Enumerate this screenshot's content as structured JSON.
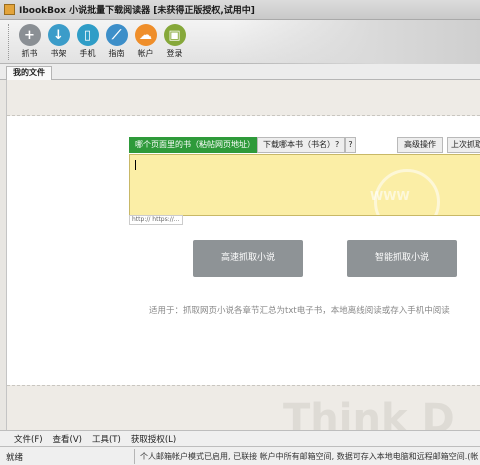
{
  "window": {
    "title": "IbookBox 小说批量下载阅读器 [未获得正版授权,试用中]"
  },
  "toolbar": {
    "buttons": [
      {
        "label": "抓书",
        "icon": "plus-icon",
        "glyph": "+"
      },
      {
        "label": "书架",
        "icon": "download-icon",
        "glyph": "↓"
      },
      {
        "label": "手机",
        "icon": "phone-icon",
        "glyph": "▯"
      },
      {
        "label": "指南",
        "icon": "chart-icon",
        "glyph": "⟋"
      },
      {
        "label": "帐户",
        "icon": "cloud-icon",
        "glyph": "☁"
      },
      {
        "label": "登录",
        "icon": "lock-icon",
        "glyph": "🔒"
      }
    ]
  },
  "tabs": {
    "active": "我的文件"
  },
  "main": {
    "url_tab": "哪个页面里的书（粘帖网页地址）",
    "book_tab": "下载哪本书（书名）?",
    "help": "?",
    "advanced": "高级操作",
    "last_grab": "上次抓取",
    "url_value": "",
    "url_hint": "http:// https://...",
    "watermark_text": "WWW",
    "fast_button": "高速抓取小说",
    "smart_button": "智能抓取小说",
    "hint": "适用于：抓取网页小说各章节汇总为txt电子书，本地离线阅读或存入手机中阅读",
    "brand_watermark": "Think D"
  },
  "menu": {
    "items": [
      "文件(F)",
      "查看(V)",
      "工具(T)",
      "获取授权(L)"
    ]
  },
  "status": {
    "left": "就绪",
    "message": "个人邮箱帐户模式已启用, 已联接 帐户中所有邮箱空间, 数据可存入本地电脑和远程邮箱空间.(帐"
  },
  "colors": {
    "url_tab_bg": "#2e9a3a",
    "url_box_bg": "#fbeea6",
    "action_button_bg": "#8e9396"
  }
}
